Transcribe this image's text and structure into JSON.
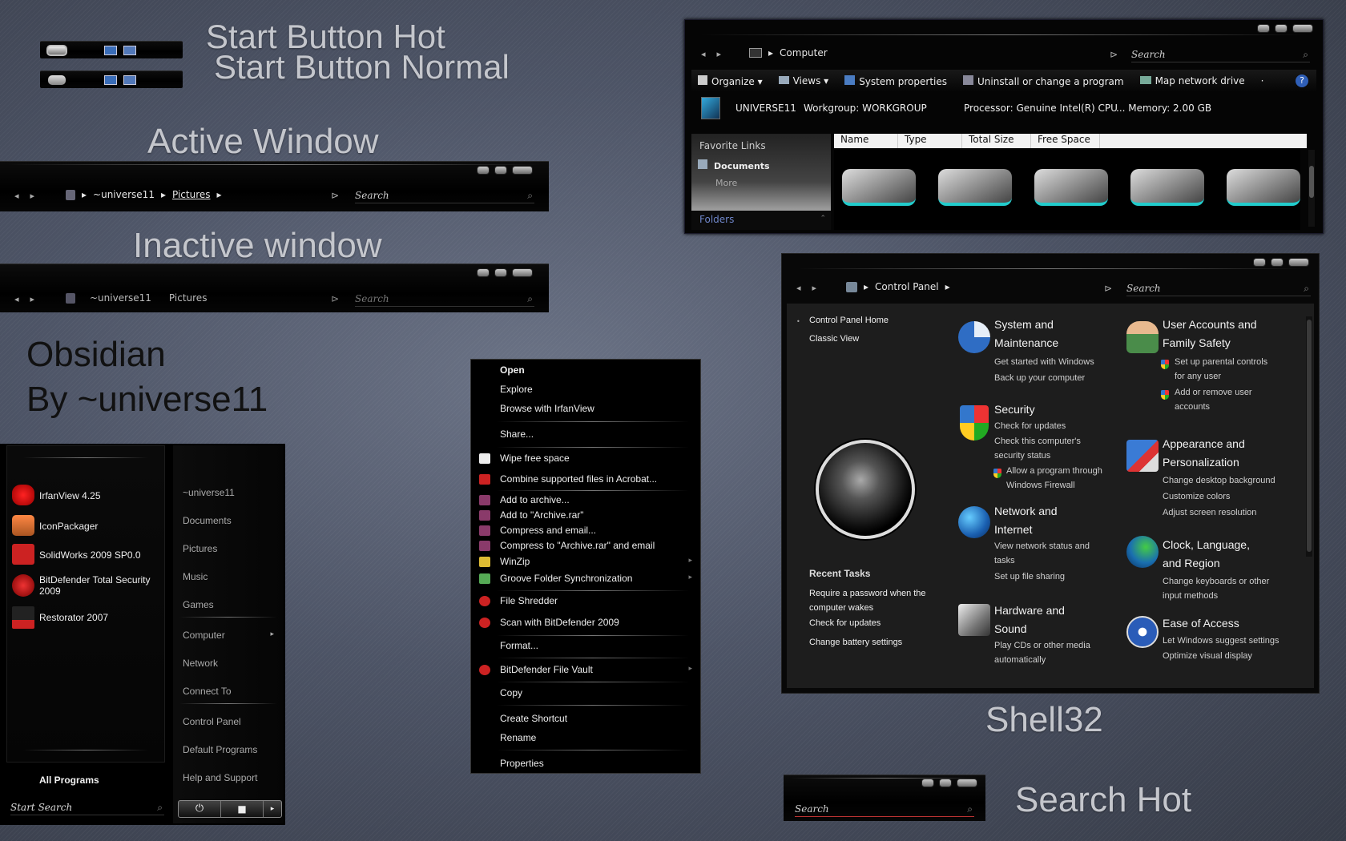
{
  "labels": {
    "start_hot": "Start Button Hot",
    "start_normal": "Start Button Normal",
    "active": "Active Window",
    "inactive": "Inactive window",
    "title1": "Obsidian",
    "title2": "By ~universe11",
    "shell": "Shell32",
    "search_hot": "Search Hot"
  },
  "active_window": {
    "crumbs": [
      "~universe11",
      "Pictures"
    ],
    "search": "Search"
  },
  "inactive_window": {
    "crumbs": [
      "~universe11",
      "Pictures"
    ],
    "search": "Search"
  },
  "computer": {
    "crumb": "Computer",
    "search": "Search",
    "toolbar": [
      "Organize",
      "Views",
      "System properties",
      "Uninstall or change a program",
      "Map network drive"
    ],
    "info": {
      "name": "UNIVERSE11",
      "workgroup": "Workgroup:  WORKGROUP",
      "processor": "Processor:  Genuine Intel(R) CPU",
      "memory": "... Memory:  2.00 GB"
    },
    "fav": "Favorite Links",
    "docs": "Documents",
    "more": "More",
    "folders": "Folders",
    "columns": [
      "Name",
      "Type",
      "Total Size",
      "Free Space"
    ]
  },
  "control_panel": {
    "crumb": "Control Panel",
    "search": "Search",
    "sidebar": [
      "Control Panel Home",
      "Classic View"
    ],
    "recent_title": "Recent Tasks",
    "recent": [
      "Require a password when the computer wakes",
      "Check for updates",
      "Change battery settings"
    ],
    "cats": [
      {
        "t1": "System and",
        "t2": "Maintenance",
        "subs": [
          "Get started with Windows",
          "Back up your computer"
        ]
      },
      {
        "t1": "Security",
        "t2": "",
        "subs": [
          "Check for updates",
          "Check this computer's",
          "security status"
        ],
        "shield": [
          "Allow a program through",
          "Windows Firewall"
        ]
      },
      {
        "t1": "Network and",
        "t2": "Internet",
        "subs": [
          "View network status and",
          "tasks",
          "Set up file sharing"
        ]
      },
      {
        "t1": "Hardware and",
        "t2": "Sound",
        "subs": [
          "Play CDs or other media",
          "automatically"
        ]
      },
      {
        "t1": "User Accounts and",
        "t2": "Family Safety",
        "shield1": [
          "Set up parental controls",
          "for any user"
        ],
        "shield2": [
          "Add or remove user",
          "accounts"
        ]
      },
      {
        "t1": "Appearance and",
        "t2": "Personalization",
        "subs": [
          "Change desktop background",
          "Customize colors",
          "Adjust screen resolution"
        ]
      },
      {
        "t1": "Clock, Language,",
        "t2": "and Region",
        "subs": [
          "Change keyboards or other",
          "input methods"
        ]
      },
      {
        "t1": "Ease of Access",
        "t2": "",
        "subs": [
          "Let Windows suggest settings",
          "Optimize visual display"
        ]
      }
    ]
  },
  "context_menu": [
    "Open",
    "Explore",
    "Browse with IrfanView",
    "Share...",
    "Wipe free space",
    "Combine supported files in Acrobat...",
    "Add to archive...",
    "Add to \"Archive.rar\"",
    "Compress and email...",
    "Compress to \"Archive.rar\" and email",
    "WinZip",
    "Groove Folder Synchronization",
    "File Shredder",
    "Scan with BitDefender 2009",
    "Format...",
    "BitDefender File Vault",
    "Copy",
    "Create Shortcut",
    "Rename",
    "Properties"
  ],
  "start_menu": {
    "pinned": [
      "IrfanView 4.25",
      "IconPackager",
      "SolidWorks 2009 SP0.0",
      "BitDefender Total Security 2009",
      "Restorator 2007"
    ],
    "right": [
      "~universe11",
      "Documents",
      "Pictures",
      "Music",
      "Games",
      "Computer",
      "Network",
      "Connect To",
      "Control Panel",
      "Default Programs",
      "Help and Support"
    ],
    "all_programs": "All Programs",
    "search": "Start Search"
  },
  "search_hot": {
    "search": "Search"
  }
}
